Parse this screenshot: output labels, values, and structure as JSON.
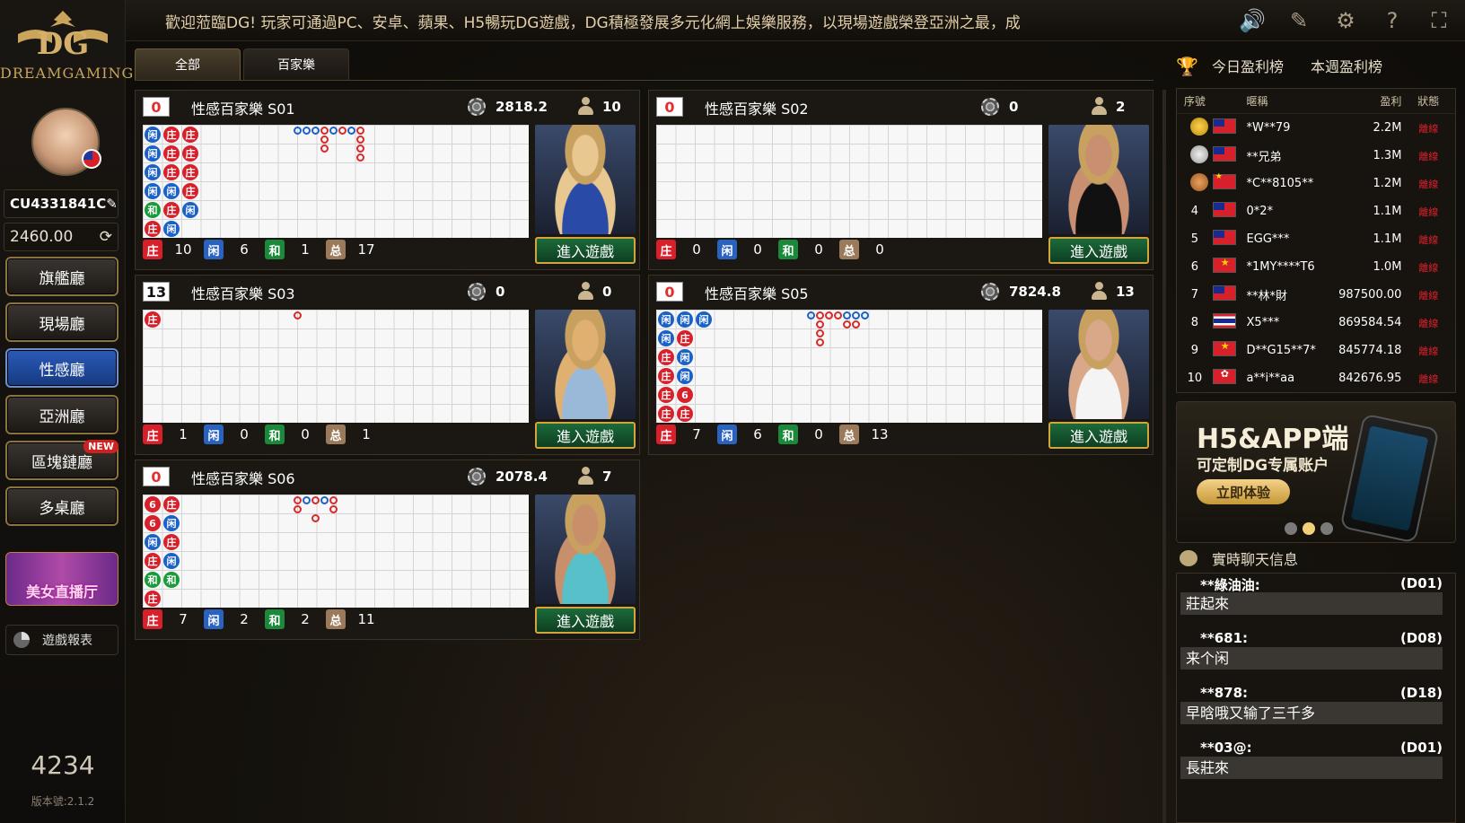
{
  "app": {
    "logo_text": "DREAMGAMING"
  },
  "topbar": {
    "marquee": "歡迎蒞臨DG! 玩家可通過PC、安卓、蘋果、H5暢玩DG遊戲，DG積極發展多元化網上娛樂服務，以現場遊戲榮登亞洲之最，成",
    "icons": [
      "speaker-icon",
      "edit-icon",
      "gear-icon",
      "help-icon",
      "fullscreen-icon"
    ]
  },
  "user": {
    "id": "CU4331841C",
    "balance": "2460.00"
  },
  "nav": [
    {
      "label": "旗艦廳",
      "active": false
    },
    {
      "label": "現場廳",
      "active": false
    },
    {
      "label": "性感廳",
      "active": true
    },
    {
      "label": "亞洲廳",
      "active": false
    },
    {
      "label": "區塊鏈廳",
      "active": false,
      "badge": "NEW"
    },
    {
      "label": "多桌廳",
      "active": false
    }
  ],
  "promo_side": "美女直播厅",
  "report_label": "遊戲報表",
  "online_count": "4234",
  "version": "版本號:2.1.2",
  "tabs": [
    {
      "label": "全部"
    },
    {
      "label": "百家樂"
    }
  ],
  "enter_label": "進入遊戲",
  "stat_labels": {
    "banker": "庄",
    "player": "闲",
    "tie": "和",
    "total": "总"
  },
  "tables": [
    {
      "shoe": "0",
      "name": "性感百家樂 S01",
      "chips": "2818.2",
      "players": "10",
      "banker": "10",
      "player": "6",
      "tie": "1",
      "total": "17"
    },
    {
      "shoe": "0",
      "name": "性感百家樂 S02",
      "chips": "0",
      "players": "2",
      "banker": "0",
      "player": "0",
      "tie": "0",
      "total": "0"
    },
    {
      "shoe": "13",
      "name": "性感百家樂 S03",
      "chips": "0",
      "players": "0",
      "banker": "1",
      "player": "0",
      "tie": "0",
      "total": "1"
    },
    {
      "shoe": "0",
      "name": "性感百家樂 S05",
      "chips": "7824.8",
      "players": "13",
      "banker": "7",
      "player": "6",
      "tie": "0",
      "total": "13"
    },
    {
      "shoe": "0",
      "name": "性感百家樂 S06",
      "chips": "2078.4",
      "players": "7",
      "banker": "7",
      "player": "2",
      "tie": "2",
      "total": "11"
    }
  ],
  "leaderboard": {
    "tabs": [
      "今日盈利榜",
      "本週盈利榜"
    ],
    "headers": [
      "序號",
      "暱稱",
      "盈利",
      "狀態"
    ],
    "rows": [
      {
        "rank": "",
        "medal": "gold",
        "flag": "tw",
        "name": "*W**79",
        "profit": "2.2M",
        "status": "離線"
      },
      {
        "rank": "",
        "medal": "silver",
        "flag": "tw",
        "name": "**兄弟",
        "profit": "1.3M",
        "status": "離線"
      },
      {
        "rank": "",
        "medal": "bronze",
        "flag": "cn",
        "name": "*C**8105**",
        "profit": "1.2M",
        "status": "離線"
      },
      {
        "rank": "4",
        "medal": "",
        "flag": "tw",
        "name": "0*2*",
        "profit": "1.1M",
        "status": "離線"
      },
      {
        "rank": "5",
        "medal": "",
        "flag": "tw",
        "name": "EGG***",
        "profit": "1.1M",
        "status": "離線"
      },
      {
        "rank": "6",
        "medal": "",
        "flag": "vn",
        "name": "*1MY****T6",
        "profit": "1.0M",
        "status": "離線"
      },
      {
        "rank": "7",
        "medal": "",
        "flag": "tw",
        "name": "**林*財",
        "profit": "987500.00",
        "status": "離線"
      },
      {
        "rank": "8",
        "medal": "",
        "flag": "th",
        "name": "X5***",
        "profit": "869584.54",
        "status": "離線"
      },
      {
        "rank": "9",
        "medal": "",
        "flag": "vn",
        "name": "D**G15**7*",
        "profit": "845774.18",
        "status": "離線"
      },
      {
        "rank": "10",
        "medal": "",
        "flag": "hk",
        "name": "a**i**aa",
        "profit": "842676.95",
        "status": "離線"
      }
    ]
  },
  "banner": {
    "title": "H5&APP端",
    "subtitle": "可定制DG专属账户",
    "button": "立即体验"
  },
  "chat": {
    "title": "實時聊天信息",
    "messages": [
      {
        "user": "**綠油油:",
        "room": "(D01)",
        "text": "莊起來"
      },
      {
        "user": "**681:",
        "room": "(D08)",
        "text": "来个闲"
      },
      {
        "user": "**878:",
        "room": "(D18)",
        "text": "早晗哦又输了三千多"
      },
      {
        "user": "**03@:",
        "room": "(D01)",
        "text": "長莊來"
      }
    ]
  }
}
